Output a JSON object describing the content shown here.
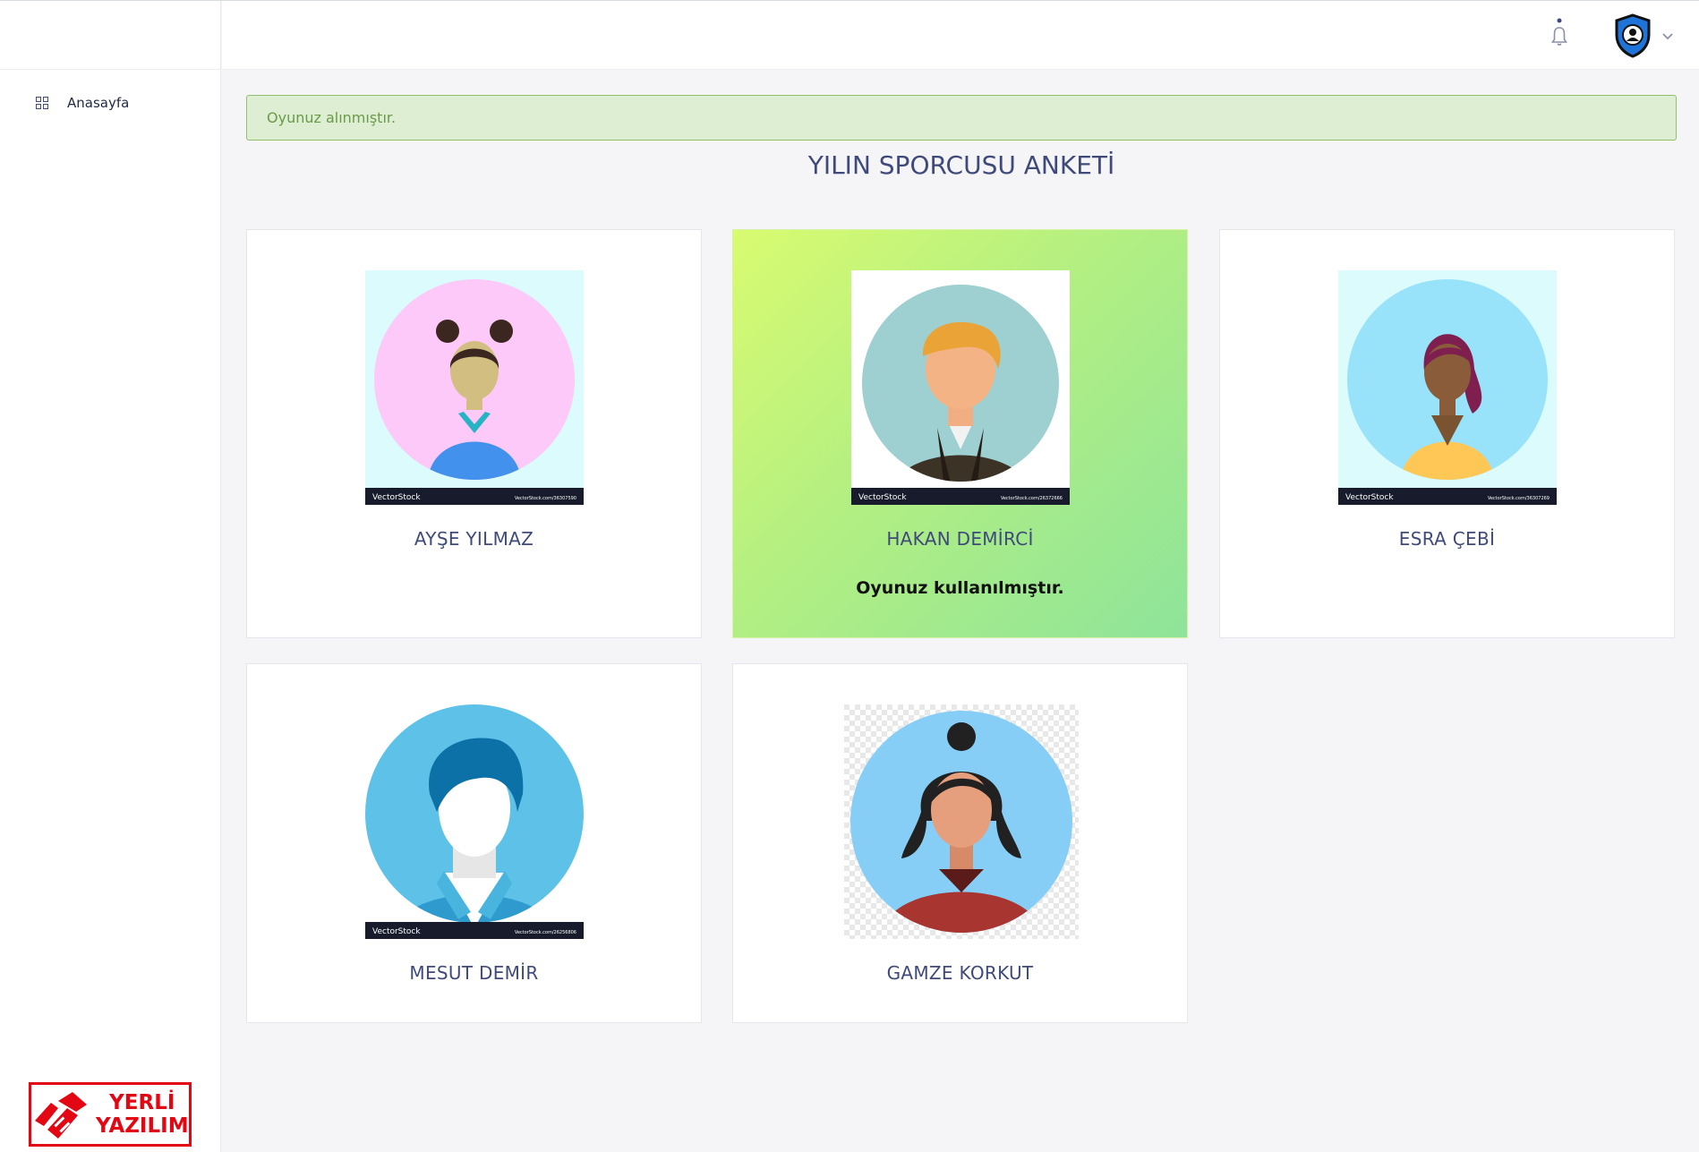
{
  "sidebar": {
    "items": [
      {
        "label": "Anasayfa",
        "icon": "dashboard-grid-icon"
      }
    ],
    "logo": {
      "line1": "YERLİ",
      "line2": "YAZILIM",
      "color": "#e30613"
    }
  },
  "header": {
    "notification_icon": "bell-icon",
    "user_icon": "shield-user-icon",
    "dropdown_icon": "chevron-down-icon"
  },
  "alert": {
    "message": "Oyunuz alınmıştır.",
    "color": "#deeed3"
  },
  "survey": {
    "title": "YILIN SPORCUSU ANKETİ",
    "candidates": [
      {
        "name": "AYŞE YILMAZ",
        "voted": false,
        "watermark": "VectorStock",
        "watermark_url": "VectorStock.com/36307590"
      },
      {
        "name": "HAKAN DEMİRCİ",
        "voted": true,
        "vote_note": "Oyunuz kullanılmıştır.",
        "watermark": "VectorStock",
        "watermark_url": "VectorStock.com/26372666"
      },
      {
        "name": "ESRA ÇEBİ",
        "voted": false,
        "watermark": "VectorStock",
        "watermark_url": "VectorStock.com/36307269"
      },
      {
        "name": "MESUT DEMİR",
        "voted": false,
        "watermark": "VectorStock",
        "watermark_url": "VectorStock.com/26256806"
      },
      {
        "name": "GAMZE KORKUT",
        "voted": false
      }
    ]
  },
  "colors": {
    "accent": "#3f4a7a",
    "voted_gradient_start": "#d9fb70",
    "voted_gradient_end": "#8ee49a"
  }
}
